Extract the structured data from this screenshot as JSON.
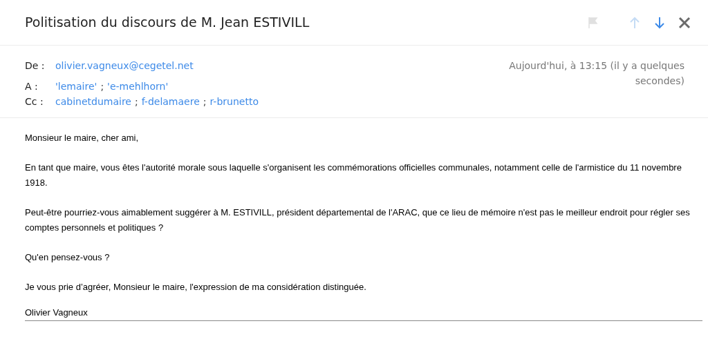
{
  "subject": "Politisation du discours de M. Jean ESTIVILL",
  "toolbar": [
    {
      "kind": "flag",
      "disabled": true
    },
    {
      "kind": "up",
      "disabled": true
    },
    {
      "kind": "down",
      "disabled": false
    },
    {
      "kind": "close",
      "disabled": false
    }
  ],
  "header": {
    "fields": [
      {
        "label": "De :",
        "recipients": [
          "olivier.vagneux@cegetel.net"
        ]
      },
      {
        "label": "A :",
        "separator": ";",
        "recipients": [
          "'lemaire'",
          "'e-mehlhorn'"
        ]
      },
      {
        "label": "Cc :",
        "separator": ";",
        "recipients": [
          "cabinetdumaire",
          "f-delamaere",
          "r-brunetto"
        ]
      }
    ],
    "date": "Aujourd'hui, à 13:15 (il y a quelques secondes)"
  },
  "body": [
    "Monsieur le maire, cher ami,",
    "En tant que maire, vous êtes l'autorité morale sous laquelle s'organisent les commémorations officielles communales, notamment celle de l'armistice du 11 novembre 1918.",
    "Peut-être pourriez-vous aimablement suggérer à M. ESTIVILL, président départemental de l'ARAC, que ce lieu de mémoire n'est pas le meilleur endroit pour régler ses comptes personnels et politiques ?",
    "Qu'en pensez-vous ?",
    "Je vous prie d’agréer, Monsieur le maire, l'expression de ma considération distinguée."
  ],
  "signature": "Olivier Vagneux"
}
